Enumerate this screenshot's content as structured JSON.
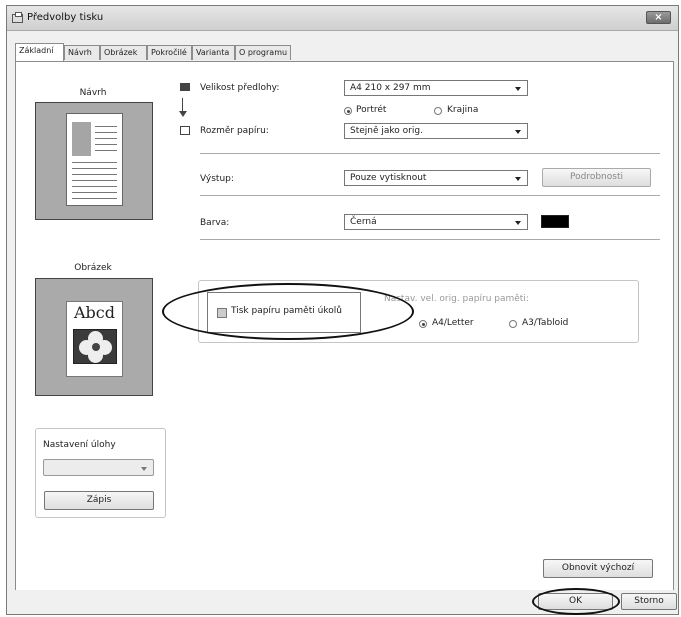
{
  "window": {
    "title": "Předvolby tisku"
  },
  "tabs": [
    "Základní",
    "Návrh",
    "Obrázek",
    "Pokročilé",
    "Varianta",
    "O programu"
  ],
  "left": {
    "preview_title": "Návrh",
    "picture_title": "Obrázek",
    "picture_text": "Abcd",
    "job_settings_label": "Nastavení úlohy",
    "register_button": "Zápis"
  },
  "main": {
    "original_size_label": "Velikost předlohy:",
    "original_size_value": "A4 210 x 297 mm",
    "portrait_label": "Portrét",
    "landscape_label": "Krajina",
    "paper_size_label": "Rozměr papíru:",
    "paper_size_value": "Stejně jako orig.",
    "output_label": "Výstup:",
    "output_value": "Pouze vytisknout",
    "details_button": "Podrobnosti",
    "color_label": "Barva:",
    "color_value": "Černá",
    "print_memory_paper": "Tisk papíru paměti úkolů",
    "memory_size_label": "Nastav. vel. orig. papíru paměti:",
    "a4_label": "A4/Letter",
    "a3_label": "A3/Tabloid",
    "restore_defaults": "Obnovit výchozí"
  },
  "footer": {
    "ok": "OK",
    "cancel": "Storno"
  },
  "colors": {
    "preview_gray": "#aaaaaa",
    "swatch_black": "#000000"
  }
}
